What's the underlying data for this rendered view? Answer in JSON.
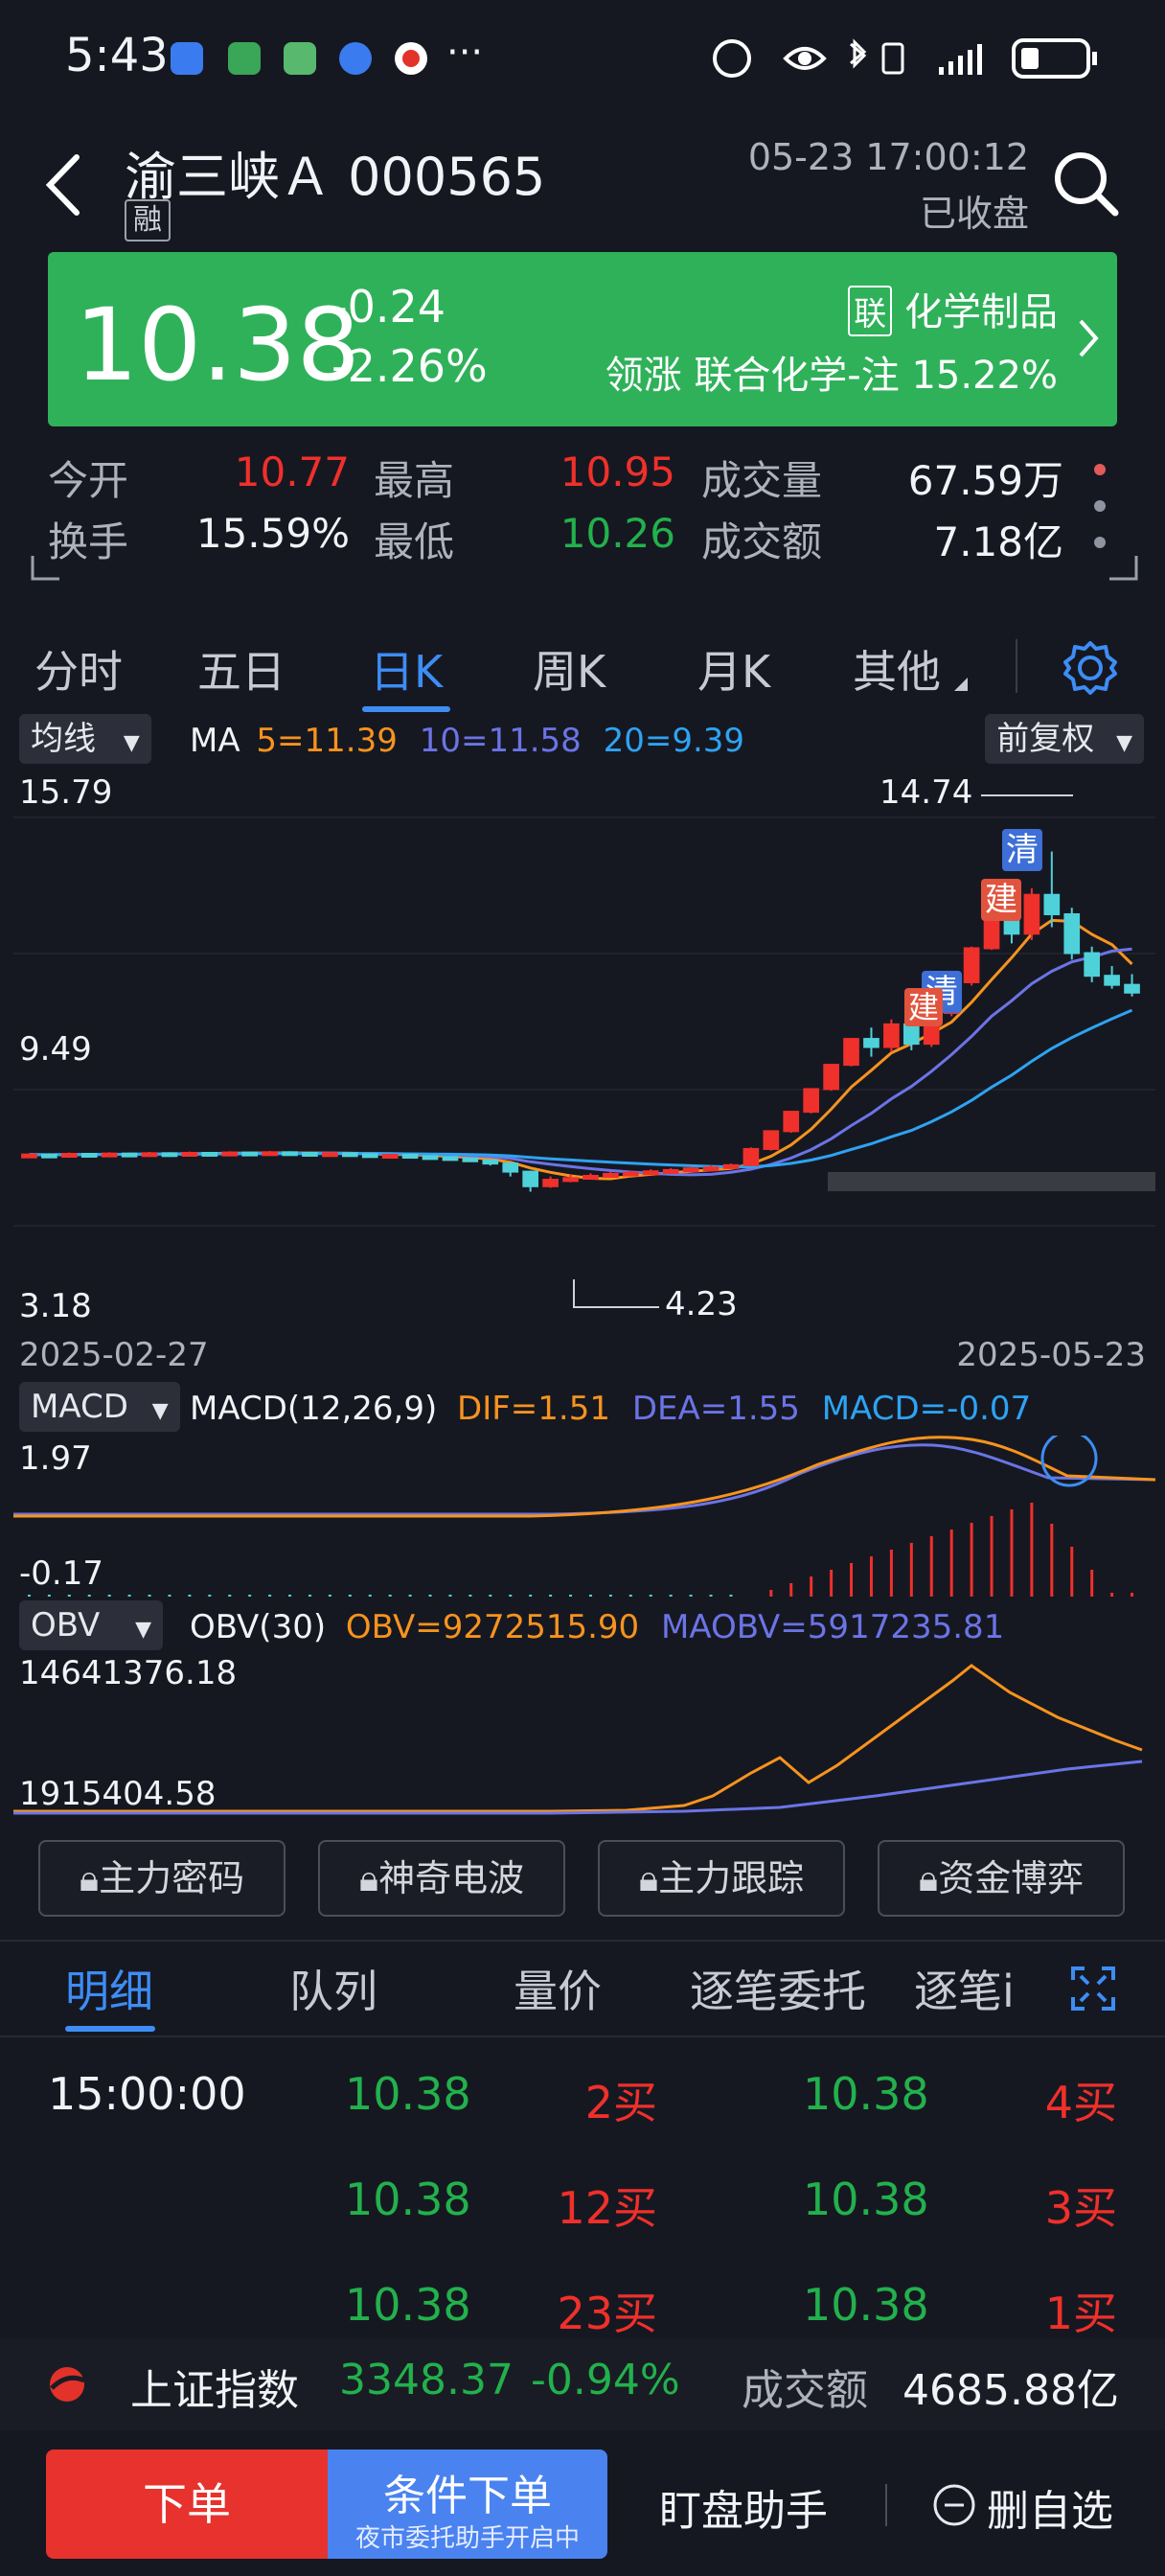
{
  "status_bar": {
    "time": "5:43",
    "more": "···"
  },
  "header": {
    "stock_name": "渝三峡Ａ",
    "stock_code": "000565",
    "margin_badge": "融",
    "datetime": "05-23 17:00:12",
    "market_status": "已收盘"
  },
  "quote": {
    "price": "10.38",
    "change": "-0.24",
    "change_pct": "-2.26%",
    "sector_badge": "联",
    "sector": "化学制品",
    "leader_label": "领涨",
    "leader_name": "联合化学-注",
    "leader_pct": "15.22%"
  },
  "stats": {
    "open_label": "今开",
    "open": "10.77",
    "high_label": "最高",
    "high": "10.95",
    "volume_label": "成交量",
    "volume": "67.59万",
    "turnover_label": "换手",
    "turnover": "15.59%",
    "low_label": "最低",
    "low": "10.26",
    "amount_label": "成交额",
    "amount": "7.18亿"
  },
  "period_tabs": [
    {
      "label": "分时"
    },
    {
      "label": "五日"
    },
    {
      "label": "日K"
    },
    {
      "label": "周K"
    },
    {
      "label": "月K"
    },
    {
      "label": "其他"
    }
  ],
  "active_tab": "日K",
  "ma_panel": {
    "selector": "均线",
    "label": "MA",
    "ma5": "5=11.39",
    "ma10": "10=11.58",
    "ma20": "20=9.39",
    "adjust": "前复权",
    "y_top": "15.79",
    "y_mid": "9.49",
    "y_bottom": "3.18",
    "max_label": "14.74",
    "min_label": "4.23",
    "date_start": "2025-02-27",
    "date_end": "2025-05-23",
    "marker_build": "建",
    "marker_clear": "清"
  },
  "macd_panel": {
    "selector": "MACD",
    "label": "MACD(12,26,9)",
    "dif": "DIF=1.51",
    "dea": "DEA=1.55",
    "macd": "MACD=-0.07",
    "y_top": "1.97",
    "y_bottom": "-0.17"
  },
  "obv_panel": {
    "selector": "OBV",
    "label": "OBV(30)",
    "obv": "OBV=9272515.90",
    "maobv": "MAOBV=5917235.81",
    "y_top": "14641376.18",
    "y_bottom": "1915404.58"
  },
  "colors": {
    "up": "#f0302b",
    "down": "#4fd1d9",
    "ma5": "#f7931e",
    "ma10": "#6b74e6",
    "ma20": "#2ea3f2",
    "quote_bg": "#2fb15a",
    "bg": "#161821",
    "accent": "#3d8df5"
  },
  "feature_buttons": [
    {
      "label": "主力密码"
    },
    {
      "label": "神奇电波"
    },
    {
      "label": "主力跟踪"
    },
    {
      "label": "资金博弈"
    }
  ],
  "detail_tabs": [
    {
      "label": "明细"
    },
    {
      "label": "队列"
    },
    {
      "label": "量价"
    },
    {
      "label": "逐笔委托"
    },
    {
      "label": "逐笔i"
    }
  ],
  "detail_rows": [
    {
      "time": "15:00:00",
      "p1": "10.38",
      "v1": "2买",
      "p2": "10.38",
      "v2": "4买"
    },
    {
      "time": "",
      "p1": "10.38",
      "v1": "12买",
      "p2": "10.38",
      "v2": "3买"
    },
    {
      "time": "",
      "p1": "10.38",
      "v1": "23买",
      "p2": "10.38",
      "v2": "1买"
    }
  ],
  "index_bar": {
    "name": "上证指数",
    "value": "3348.37",
    "pct": "-0.94%",
    "amount_label": "成交额",
    "amount": "4685.88亿"
  },
  "action_bar": {
    "order": "下单",
    "cond_order": "条件下单",
    "cond_sub": "夜市委托助手开启中",
    "assistant": "盯盘助手",
    "remove": "删自选"
  },
  "chart_data": {
    "type": "candlestick",
    "x_range": [
      "2025-02-27",
      "2025-05-23"
    ],
    "ylim": [
      3.18,
      15.79
    ],
    "max": 14.74,
    "min": 4.23,
    "ma": {
      "ma5": 11.39,
      "ma10": 11.58,
      "ma20": 9.39
    },
    "candles": [
      [
        5.35,
        5.38,
        5.3,
        5.4
      ],
      [
        5.38,
        5.36,
        5.32,
        5.42
      ],
      [
        5.36,
        5.4,
        5.34,
        5.44
      ],
      [
        5.4,
        5.37,
        5.33,
        5.42
      ],
      [
        5.37,
        5.41,
        5.35,
        5.45
      ],
      [
        5.41,
        5.39,
        5.35,
        5.44
      ],
      [
        5.39,
        5.42,
        5.37,
        5.46
      ],
      [
        5.42,
        5.4,
        5.36,
        5.45
      ],
      [
        5.4,
        5.43,
        5.38,
        5.47
      ],
      [
        5.43,
        5.41,
        5.37,
        5.46
      ],
      [
        5.41,
        5.44,
        5.39,
        5.48
      ],
      [
        5.44,
        5.42,
        5.38,
        5.47
      ],
      [
        5.42,
        5.45,
        5.4,
        5.49
      ],
      [
        5.45,
        5.43,
        5.39,
        5.48
      ],
      [
        5.43,
        5.4,
        5.36,
        5.46
      ],
      [
        5.4,
        5.42,
        5.37,
        5.45
      ],
      [
        5.42,
        5.39,
        5.35,
        5.44
      ],
      [
        5.39,
        5.35,
        5.31,
        5.41
      ],
      [
        5.35,
        5.37,
        5.32,
        5.4
      ],
      [
        5.37,
        5.33,
        5.3,
        5.39
      ],
      [
        5.33,
        5.3,
        5.26,
        5.35
      ],
      [
        5.3,
        5.26,
        5.22,
        5.32
      ],
      [
        5.26,
        5.2,
        5.15,
        5.28
      ],
      [
        5.2,
        5.1,
        5.04,
        5.22
      ],
      [
        5.1,
        4.85,
        4.7,
        5.12
      ],
      [
        4.85,
        4.4,
        4.23,
        4.88
      ],
      [
        4.4,
        4.6,
        4.35,
        4.7
      ],
      [
        4.6,
        4.65,
        4.52,
        4.75
      ],
      [
        4.65,
        4.72,
        4.6,
        4.8
      ],
      [
        4.72,
        4.78,
        4.66,
        4.84
      ],
      [
        4.78,
        4.82,
        4.72,
        4.88
      ],
      [
        4.82,
        4.86,
        4.76,
        4.92
      ],
      [
        4.86,
        4.9,
        4.8,
        4.96
      ],
      [
        4.9,
        4.95,
        4.85,
        5.0
      ],
      [
        4.95,
        4.98,
        4.88,
        5.05
      ],
      [
        4.98,
        5.05,
        4.93,
        5.1
      ],
      [
        5.05,
        5.55,
        5.02,
        5.6
      ],
      [
        5.55,
        6.1,
        5.5,
        6.12
      ],
      [
        6.1,
        6.7,
        6.05,
        6.72
      ],
      [
        6.7,
        7.4,
        6.65,
        7.42
      ],
      [
        7.4,
        8.15,
        7.35,
        8.18
      ],
      [
        8.15,
        8.95,
        8.1,
        8.98
      ],
      [
        8.95,
        8.7,
        8.4,
        9.3
      ],
      [
        8.7,
        9.4,
        8.55,
        9.55
      ],
      [
        9.4,
        8.8,
        8.6,
        9.6
      ],
      [
        8.8,
        9.75,
        8.7,
        9.85
      ],
      [
        9.75,
        10.7,
        9.65,
        10.73
      ],
      [
        10.7,
        11.75,
        10.6,
        11.8
      ],
      [
        11.75,
        12.9,
        11.7,
        12.95
      ],
      [
        12.9,
        12.2,
        11.9,
        13.3
      ],
      [
        12.2,
        13.4,
        12.0,
        13.6
      ],
      [
        13.4,
        12.8,
        12.4,
        14.74
      ],
      [
        12.8,
        11.6,
        11.4,
        13.0
      ],
      [
        11.6,
        10.9,
        10.7,
        11.8
      ],
      [
        10.9,
        10.62,
        10.5,
        11.2
      ],
      [
        10.62,
        10.38,
        10.26,
        10.95
      ]
    ]
  }
}
